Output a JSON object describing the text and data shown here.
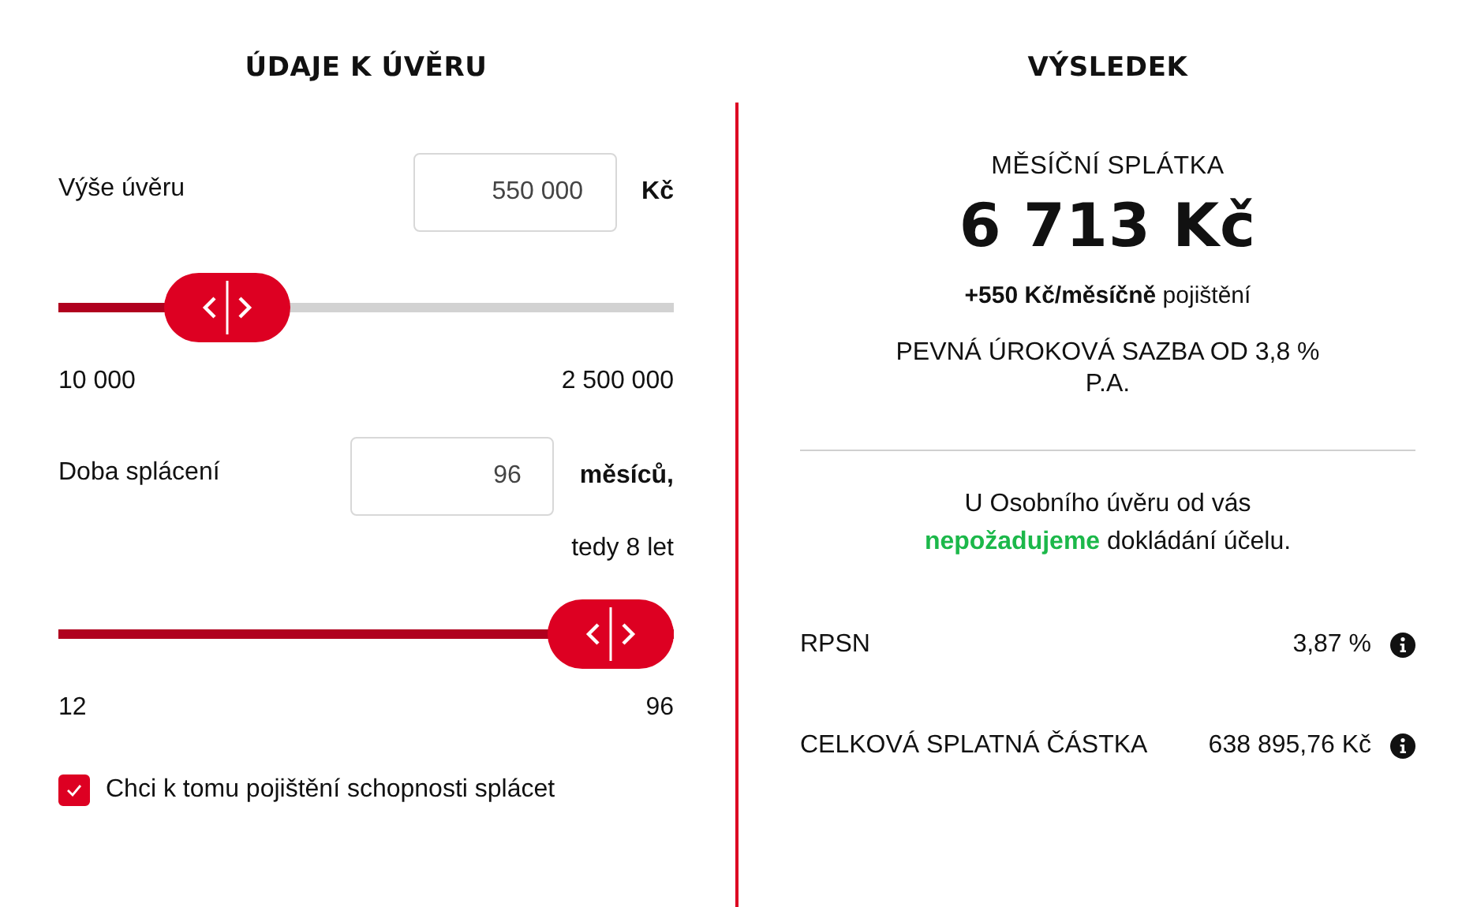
{
  "loan_details": {
    "title": "ÚDAJE K ÚVĚRU",
    "amount": {
      "label": "Výše úvěru",
      "value": "550 000",
      "unit": "Kč",
      "level": 0.217,
      "min": "10 000",
      "max": "2 500 000"
    },
    "duration": {
      "label": "Doba splácení",
      "value": "96",
      "unit": "měsíců,",
      "note": "tedy 8 let",
      "level": 1,
      "min": "12",
      "max": "96"
    },
    "insurance": {
      "label": "Chci k tomu pojištění schopnosti splácet",
      "checked": true
    }
  },
  "result": {
    "title": "VÝSLEDEK",
    "payment_label": "MĚSÍČNÍ SPLÁTKA",
    "payment": "6 713 Kč",
    "insurance_note": "**+550 Kč/měsíčně** pojištění",
    "rate": "PEVNÁ ÚROKOVÁ SAZBA OD 3,8 % P.A.",
    "purpose_note": "U Osobního úvěru od vás **nepožadujeme** dokládání účelu.",
    "rows": [
      {
        "label": "RPSN",
        "value": "3,87 %"
      },
      {
        "label": "CELKOVÁ SPLATNÁ ČÁSTKA",
        "value": "638 895,76 Kč"
      }
    ]
  }
}
